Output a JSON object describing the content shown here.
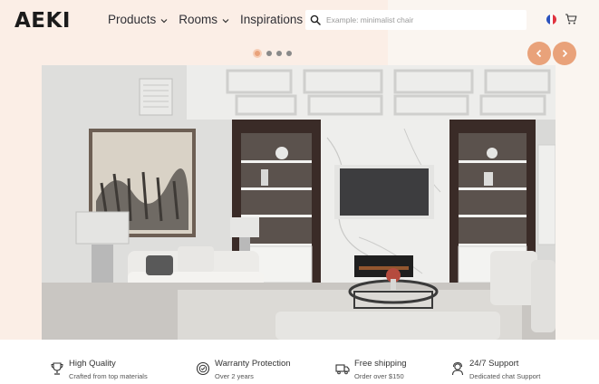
{
  "brand": {
    "logo": "AEKI"
  },
  "nav": {
    "items": [
      {
        "label": "Products",
        "has_dropdown": true
      },
      {
        "label": "Rooms",
        "has_dropdown": true
      },
      {
        "label": "Inspirations",
        "has_dropdown": false
      }
    ]
  },
  "search": {
    "placeholder": "Example: minimalist chair",
    "value": ""
  },
  "header_icons": {
    "language": "french-flag-icon",
    "cart": "cart-icon"
  },
  "carousel": {
    "slide_count": 4,
    "active_index": 0,
    "prev": "chevron-left-icon",
    "next": "chevron-right-icon"
  },
  "hero_image": {
    "alt": "living room"
  },
  "features": [
    {
      "icon": "trophy-icon",
      "title": "High Quality",
      "subtitle": "Crafted from top materials"
    },
    {
      "icon": "warranty-seal-icon",
      "title": "Warranty Protection",
      "subtitle": "Over 2 years"
    },
    {
      "icon": "truck-icon",
      "title": "Free shipping",
      "subtitle": "Order over $150"
    },
    {
      "icon": "support-agent-icon",
      "title": "24/7 Support",
      "subtitle": "Dedicated chat Support"
    }
  ],
  "colors": {
    "accent": "#e9a27a",
    "hero_bg": "#fbeee6",
    "text": "#2b2b2b"
  }
}
